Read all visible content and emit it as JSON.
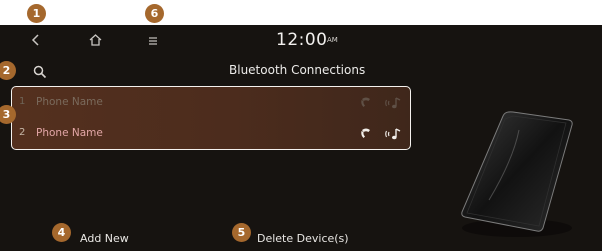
{
  "callouts": [
    "1",
    "2",
    "3",
    "4",
    "5",
    "6"
  ],
  "topbar": {
    "back_icon": "chevron-left-icon",
    "home_icon": "home-icon",
    "menu_icon": "hamburger-menu-icon",
    "time": "12:00",
    "ampm": "AM"
  },
  "header": {
    "search_icon": "search-icon",
    "title": "Bluetooth Connections"
  },
  "devices": [
    {
      "index": "1",
      "name": "Phone Name",
      "connected": false,
      "icons": [
        "phone-handset-icon",
        "audio-streaming-icon"
      ]
    },
    {
      "index": "2",
      "name": "Phone Name",
      "connected": true,
      "icons": [
        "phone-handset-icon",
        "audio-streaming-icon"
      ]
    }
  ],
  "footer": {
    "add_new": "Add New",
    "delete_devices": "Delete Device(s)"
  },
  "colors": {
    "screen_bg": "#161310",
    "list_bg": "#54301e",
    "callout": "#a5682d",
    "active_name": "#e2a6a6"
  }
}
